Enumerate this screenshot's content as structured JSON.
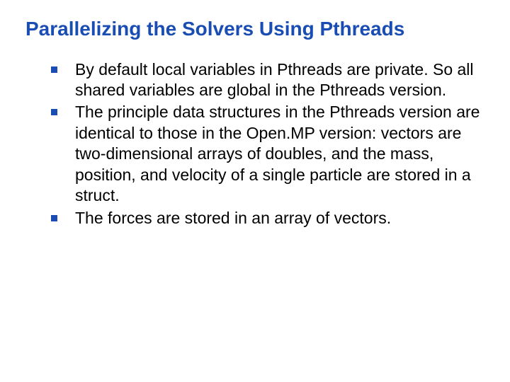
{
  "title": "Parallelizing the Solvers Using Pthreads",
  "bullets": [
    "By default local variables in Pthreads are private. So all shared variables are global in the Pthreads version.",
    "The principle data structures in the Pthreads version are identical to those in the Open.MP version: vectors are two-dimensional arrays of doubles, and the mass, position, and velocity of a single particle are stored in a struct.",
    "The forces are stored in an array of vectors."
  ]
}
